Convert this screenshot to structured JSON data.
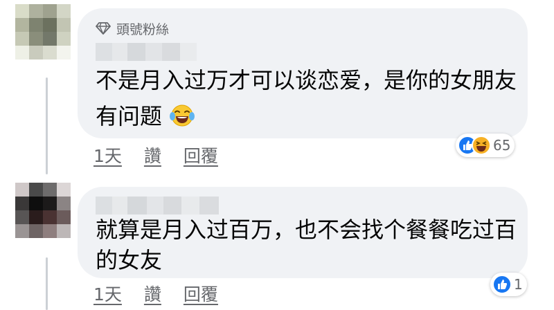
{
  "comments": [
    {
      "badge_label": "頭號粉絲",
      "text": "不是月入过万才可以谈恋爱，是你的女朋友有问题",
      "emoji_icon": "laughing-tears-emoji",
      "timestamp": "1天",
      "like_label": "讚",
      "reply_label": "回覆",
      "reaction_count": "65",
      "reactions": [
        "like",
        "haha"
      ]
    },
    {
      "text": "就算是月入过百万，也不会找个餐餐吃过百的女友",
      "timestamp": "1天",
      "like_label": "讚",
      "reply_label": "回覆",
      "reaction_count": "1",
      "reactions": [
        "like"
      ]
    }
  ],
  "colors": {
    "bubble": "#f0f2f5",
    "meta_text": "#65676b",
    "like_blue": "#1877f2",
    "haha_yellow": "#f7b125",
    "thread_line": "#ccd0d5"
  }
}
